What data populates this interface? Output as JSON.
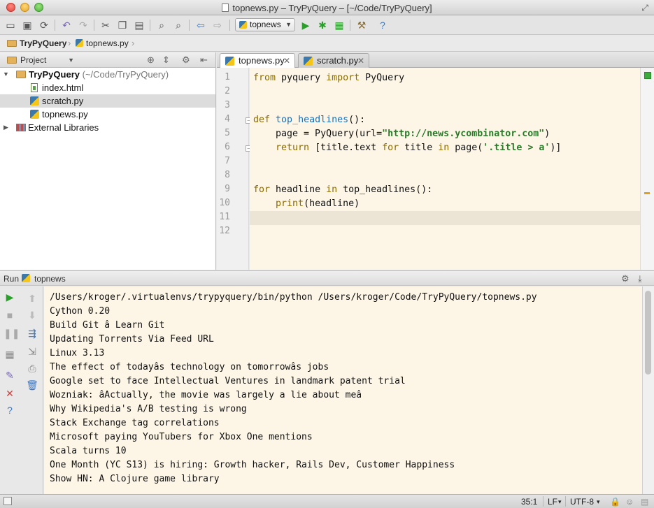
{
  "window": {
    "title": "topnews.py – TryPyQuery – [~/Code/TryPyQuery]"
  },
  "toolbar": {
    "run_config": "topnews"
  },
  "navbar": {
    "crumbs": [
      "TryPyQuery",
      "topnews.py"
    ]
  },
  "project_panel": {
    "tab_label": "Project",
    "tree": [
      {
        "label": "TryPyQuery",
        "path": "(~/Code/TryPyQuery)",
        "type": "folder"
      },
      {
        "label": "index.html",
        "type": "html"
      },
      {
        "label": "scratch.py",
        "type": "py",
        "selected": true
      },
      {
        "label": "topnews.py",
        "type": "py"
      },
      {
        "label": "External Libraries",
        "type": "lib"
      }
    ]
  },
  "editor": {
    "tabs": [
      {
        "label": "topnews.py",
        "active": true
      },
      {
        "label": "scratch.py",
        "active": false
      }
    ],
    "line_numbers": [
      "1",
      "2",
      "3",
      "4",
      "5",
      "6",
      "7",
      "8",
      "9",
      "10",
      "11",
      "12"
    ],
    "code": {
      "l1_kw1": "from",
      "l1_mod": " pyquery ",
      "l1_kw2": "import",
      "l1_name": " PyQuery",
      "l4_kw": "def",
      "l4_fn": "top_headlines",
      "l4_rest": "():",
      "l5_pre": "    page = PyQuery(url=",
      "l5_str": "\"http://news.ycombinator.com\"",
      "l5_post": ")",
      "l6_kw": "return",
      "l6_a": " [title.text ",
      "l6_for": "for",
      "l6_b": " title ",
      "l6_in": "in",
      "l6_c": " page(",
      "l6_str": "'.title > a'",
      "l6_d": ")]",
      "l9_kw": "for",
      "l9_a": " headline ",
      "l9_in": "in",
      "l9_b": " top_headlines():",
      "l10_bi": "print",
      "l10_rest": "(headline)"
    }
  },
  "run_panel": {
    "label": "Run",
    "config": "topnews",
    "output": [
      "/Users/kroger/.virtualenvs/trypyquery/bin/python /Users/kroger/Code/TryPyQuery/topnews.py",
      "Cython 0.20",
      "Build Git â Learn Git",
      "Updating Torrents Via Feed URL",
      "Linux 3.13",
      "The effect of todayâs technology on tomorrowâs jobs",
      "Google set to face Intellectual Ventures in landmark patent trial",
      "Wozniak: âActually, the movie was largely a lie about meâ",
      "Why Wikipedia's A/B testing is wrong",
      "Stack Exchange tag correlations",
      "Microsoft paying YouTubers for Xbox One mentions",
      "Scala turns 10",
      "One Month (YC S13) is hiring: Growth hacker, Rails Dev, Customer Happiness",
      "Show HN: A Clojure game library"
    ]
  },
  "statusbar": {
    "position": "35:1",
    "line_sep": "LF",
    "encoding": "UTF-8"
  }
}
